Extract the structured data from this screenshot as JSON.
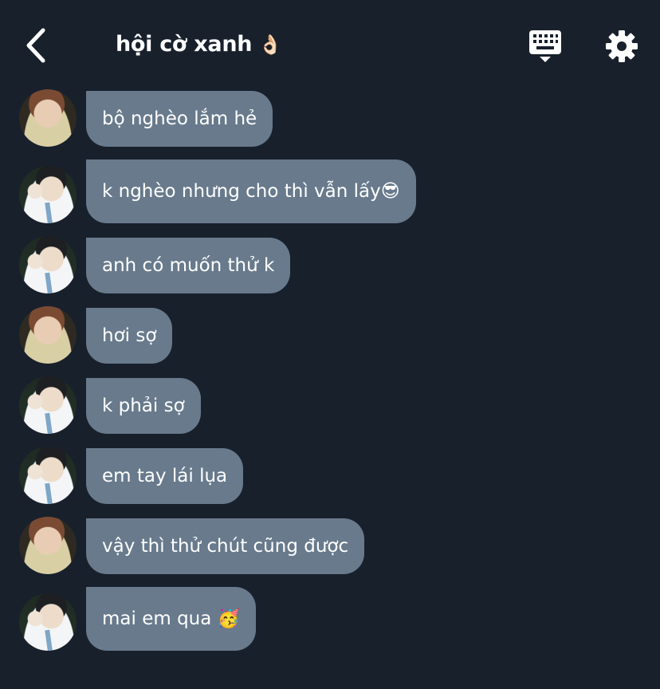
{
  "header": {
    "title": "hội cờ xanh",
    "title_emoji": "👌🏻",
    "icons": {
      "back": "chevron-left-icon",
      "keyboard": "keyboard-icon",
      "settings": "gear-icon"
    }
  },
  "messages": [
    {
      "text": "bộ nghèo lắm hẻ",
      "emoji": "",
      "avatar": "user-a"
    },
    {
      "text": "k nghèo nhưng cho thì vẫn lấy",
      "emoji": "😎",
      "avatar": "user-b"
    },
    {
      "text": "anh có muốn thử k",
      "emoji": "",
      "avatar": "user-b"
    },
    {
      "text": "hơi sợ",
      "emoji": "",
      "avatar": "user-a"
    },
    {
      "text": "k phải sợ",
      "emoji": "",
      "avatar": "user-b"
    },
    {
      "text": "em tay lái lụa",
      "emoji": "",
      "avatar": "user-b"
    },
    {
      "text": "vậy thì thử chút cũng được",
      "emoji": "",
      "avatar": "user-a"
    },
    {
      "text": "mai em qua ",
      "emoji": "🥳",
      "avatar": "user-b"
    }
  ],
  "colors": {
    "background": "#18202c",
    "bubble": "#687a8c",
    "text": "#ffffff"
  }
}
